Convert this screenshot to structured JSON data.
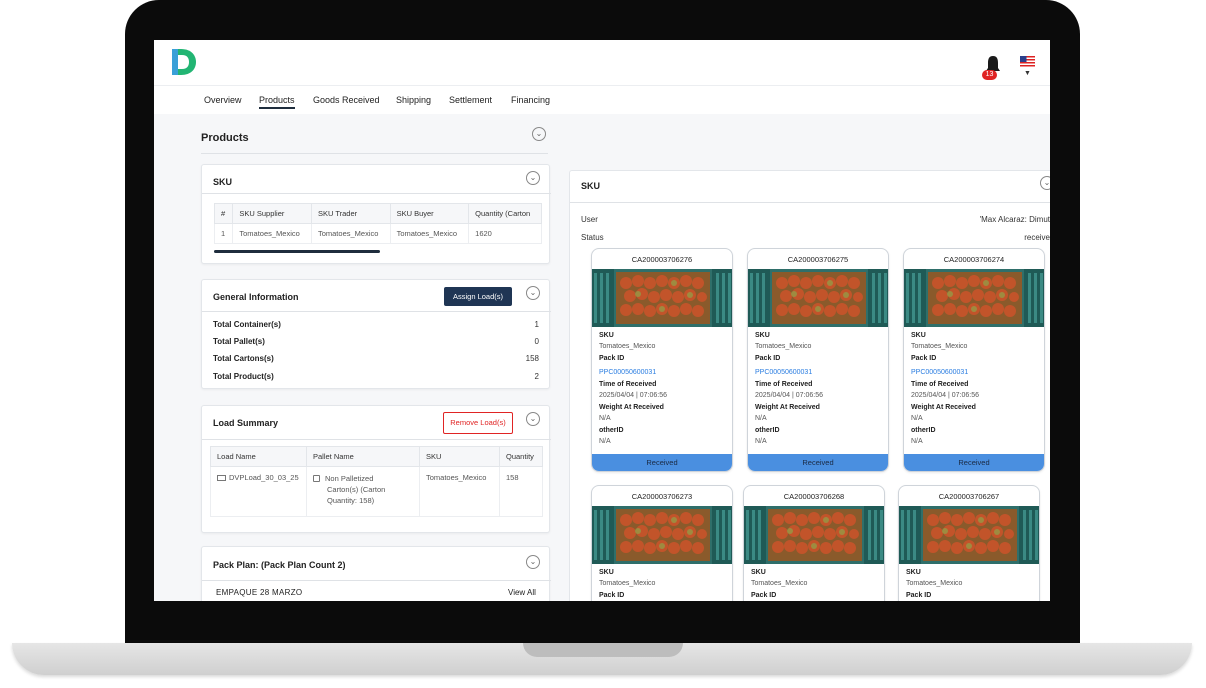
{
  "header": {
    "notifications_count": "13"
  },
  "tabs": [
    {
      "label": "Overview"
    },
    {
      "label": "Products",
      "active": true
    },
    {
      "label": "Goods Received"
    },
    {
      "label": "Shipping"
    },
    {
      "label": "Settlement"
    },
    {
      "label": "Financing"
    }
  ],
  "products": {
    "title": "Products"
  },
  "sku_card": {
    "title": "SKU",
    "columns": [
      "#",
      "SKU Supplier",
      "SKU Trader",
      "SKU Buyer",
      "Quantity (Carton"
    ],
    "rows": [
      [
        "1",
        "Tomatoes_Mexico",
        "Tomatoes_Mexico",
        "Tomatoes_Mexico",
        "1620"
      ]
    ]
  },
  "general_info": {
    "title": "General Information",
    "assign_label": "Assign Load(s)",
    "items": [
      {
        "label": "Total Container(s)",
        "value": "1"
      },
      {
        "label": "Total Pallet(s)",
        "value": "0"
      },
      {
        "label": "Total Cartons(s)",
        "value": "158"
      },
      {
        "label": "Total Product(s)",
        "value": "2"
      }
    ]
  },
  "load_summary": {
    "title": "Load Summary",
    "remove_label": "Remove Load(s)",
    "columns": [
      "Load Name",
      "Pallet Name",
      "SKU",
      "Quantity"
    ],
    "row": {
      "load_name": "DVPLoad_30_03_25",
      "pallet_line1": "Non Palletized",
      "pallet_line2": "Carton(s) (Carton",
      "pallet_line3": "Quantity: 158)",
      "sku": "Tomatoes_Mexico",
      "quantity": "158"
    }
  },
  "pack_plan": {
    "title": "Pack Plan: (Pack Plan Count 2)",
    "item": "EMPAQUE 28 MARZO",
    "view_all": "View All"
  },
  "sku_panel": {
    "title": "SKU",
    "user_label": "User",
    "user_value": "'Max Alcaraz: Dimut",
    "status_label": "Status",
    "status_value": "receive",
    "field_labels": {
      "sku": "SKU",
      "pack_id": "Pack ID",
      "time": "Time of Received",
      "weight": "Weight At Received",
      "other": "otherID"
    },
    "cards": [
      {
        "code": "CA200003706276",
        "sku": "Tomatoes_Mexico",
        "pack_id": "PPC00050600031",
        "time": "2025/04/04 | 07:06:56",
        "weight": "N/A",
        "other": "N/A",
        "status": "Received"
      },
      {
        "code": "CA200003706275",
        "sku": "Tomatoes_Mexico",
        "pack_id": "PPC00050600031",
        "time": "2025/04/04 | 07:06:56",
        "weight": "N/A",
        "other": "N/A",
        "status": "Received"
      },
      {
        "code": "CA200003706274",
        "sku": "Tomatoes_Mexico",
        "pack_id": "PPC00050600031",
        "time": "2025/04/04 | 07:06:56",
        "weight": "N/A",
        "other": "N/A",
        "status": "Received"
      },
      {
        "code": "CA200003706273",
        "sku": "Tomatoes_Mexico"
      },
      {
        "code": "CA200003706268",
        "sku": "Tomatoes_Mexico"
      },
      {
        "code": "CA200003706267",
        "sku": "Tomatoes_Mexico"
      }
    ]
  },
  "colors": {
    "brand_green": "#22b573",
    "brand_blue": "#3aa0d8",
    "navy": "#1f3554",
    "received_blue": "#4a8fe0",
    "alert_red": "#e02424",
    "link_blue": "#2a7de1"
  }
}
